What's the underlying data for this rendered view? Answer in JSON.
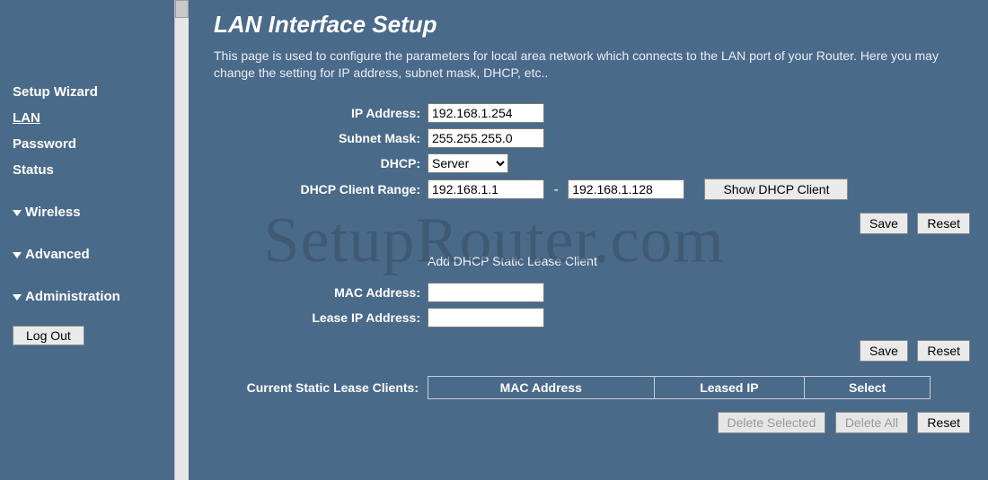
{
  "sidebar": {
    "items": [
      {
        "label": "Setup Wizard",
        "active": false
      },
      {
        "label": "LAN",
        "active": true
      },
      {
        "label": "Password",
        "active": false
      },
      {
        "label": "Status",
        "active": false
      }
    ],
    "groups": [
      {
        "label": "Wireless"
      },
      {
        "label": "Advanced"
      },
      {
        "label": "Administration"
      }
    ],
    "logout_label": "Log Out"
  },
  "page": {
    "title": "LAN Interface Setup",
    "description": "This page is used to configure the parameters for local area network which connects to the LAN port of your Router. Here you may change the setting for IP address, subnet mask, DHCP, etc.."
  },
  "form": {
    "ip_label": "IP Address:",
    "ip_value": "192.168.1.254",
    "subnet_label": "Subnet Mask:",
    "subnet_value": "255.255.255.0",
    "dhcp_label": "DHCP:",
    "dhcp_value": "Server",
    "range_label": "DHCP Client Range:",
    "range_from": "192.168.1.1",
    "range_to": "192.168.1.128",
    "range_sep": "-",
    "show_dhcp_label": "Show DHCP Client",
    "save_label": "Save",
    "reset_label": "Reset"
  },
  "static_lease": {
    "section_title": "Add DHCP Static Lease Client",
    "mac_label": "MAC Address:",
    "mac_value": "",
    "lease_ip_label": "Lease IP Address:",
    "lease_ip_value": "",
    "save_label": "Save",
    "reset_label": "Reset"
  },
  "current_clients": {
    "label": "Current Static Lease Clients:",
    "col_mac": "MAC Address",
    "col_ip": "Leased IP",
    "col_select": "Select",
    "delete_selected_label": "Delete Selected",
    "delete_all_label": "Delete All",
    "reset_label": "Reset"
  },
  "watermark": "SetupRouter.com"
}
